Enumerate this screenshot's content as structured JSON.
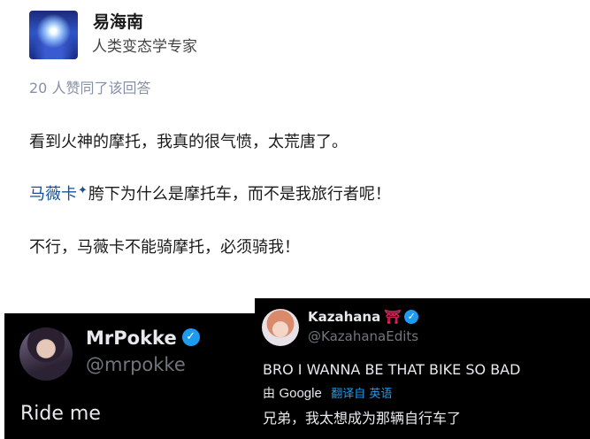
{
  "answer": {
    "author_name": "易海南",
    "author_bio": "人类变态学专家",
    "likes_text": "20 人赞同了该回答",
    "para1": "看到火神的摩托，我真的很气愤，太荒唐了。",
    "para2_mention": "马薇卡",
    "para2_rest": "胯下为什么是摩托车，而不是我旅行者呢！",
    "para3": "不行，马薇卡不能骑摩托，必须骑我！"
  },
  "tweet_left": {
    "name": "MrPokke",
    "handle": "@mrpokke",
    "text": "Ride me"
  },
  "tweet_right": {
    "name": "Kazahana",
    "name_glyph": "⛩",
    "handle": "@KazahanaEdits",
    "text": "BRO I WANNA BE THAT BIKE SO BAD",
    "by_label": "由",
    "translator": "Google",
    "translate_label": "翻译自 英语",
    "translated_text": "兄弟，我太想成为那辆自行车了"
  },
  "colors": {
    "mention": "#175199",
    "verified": "#1d9bf0",
    "muted": "#8590a6"
  },
  "icons": {
    "verified": "verified-badge-icon",
    "sparkle": "sparkle-icon"
  }
}
